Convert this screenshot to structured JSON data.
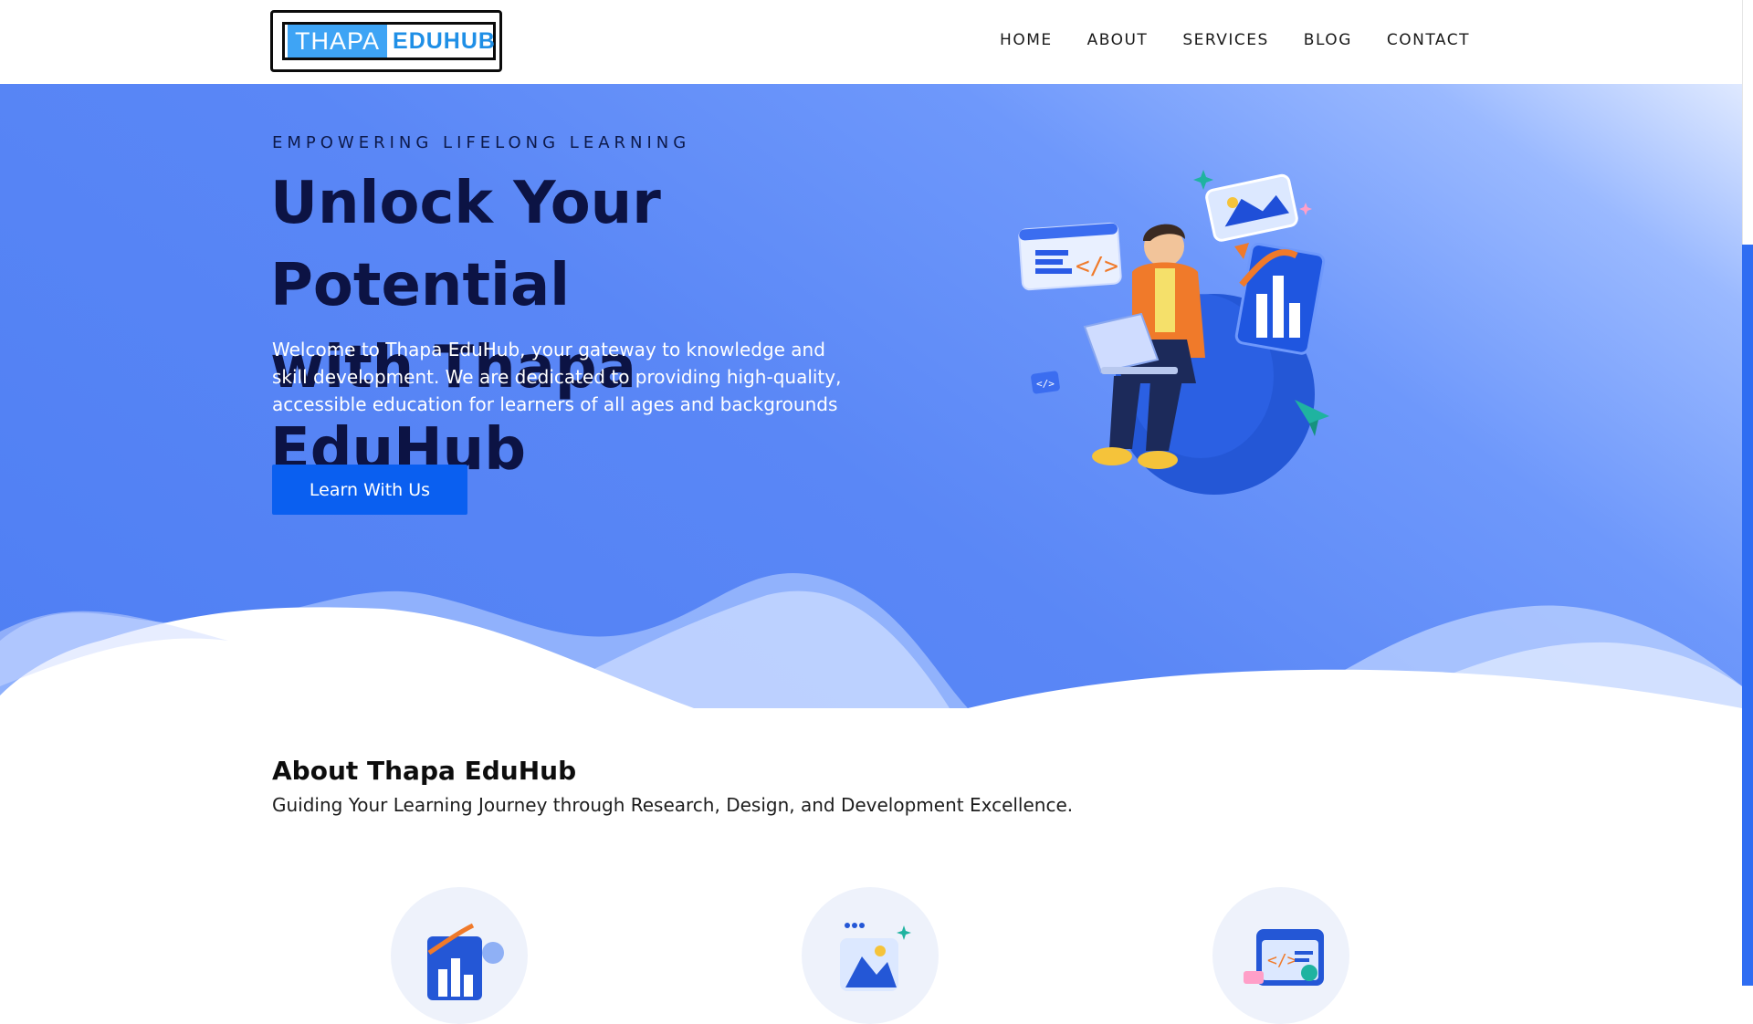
{
  "header": {
    "logo": {
      "part1": "THAPA",
      "part2": "EDUHUB"
    },
    "nav": [
      "HOME",
      "ABOUT",
      "SERVICES",
      "BLOG",
      "CONTACT"
    ]
  },
  "hero": {
    "eyebrow": "EMPOWERING LIFELONG LEARNING",
    "title_line1": "Unlock Your Potential",
    "title_line2": "with Thapa EduHub",
    "description": "Welcome to Thapa EduHub, your gateway to knowledge and skill development. We are dedicated to providing high-quality, accessible education for learners of all ages and backgrounds",
    "cta_label": "Learn With Us",
    "illustration_icon": "student-with-laptop-illustration"
  },
  "about": {
    "title": "About Thapa EduHub",
    "subtitle": "Guiding Your Learning Journey through Research, Design, and Development Excellence.",
    "cards": [
      {
        "icon": "analytics-chart-icon"
      },
      {
        "icon": "design-image-icon"
      },
      {
        "icon": "code-development-icon"
      }
    ]
  },
  "colors": {
    "primary_button": "#0a5ff0",
    "hero_blue": "#5a87f6",
    "heading_navy": "#0c1344",
    "logo_blue": "#3ea4f5"
  }
}
